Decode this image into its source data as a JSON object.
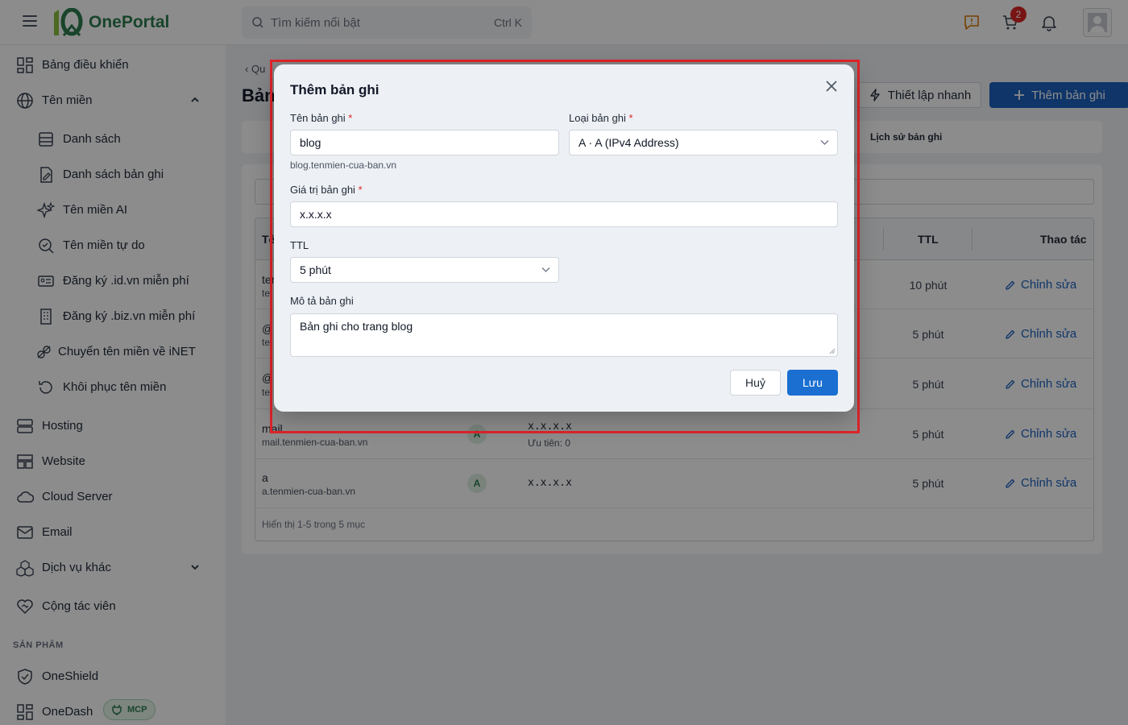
{
  "brand": {
    "name": "OnePortal",
    "accent": "#2e7d4f"
  },
  "search": {
    "placeholder": "Tìm kiếm nổi bật",
    "shortcut": "Ctrl K"
  },
  "header": {
    "cart_count": "2"
  },
  "sidebar": {
    "items": [
      {
        "label": "Bảng điều khiển",
        "icon": "dashboard-icon"
      },
      {
        "label": "Tên miền",
        "icon": "globe-icon"
      },
      {
        "label": "Danh sách",
        "icon": "list-icon"
      },
      {
        "label": "Danh sách bản ghi",
        "icon": "edit-doc-icon"
      },
      {
        "label": "Tên miền AI",
        "icon": "sparkle-icon"
      },
      {
        "label": "Tên miền tự do",
        "icon": "search-check-icon"
      },
      {
        "label": "Đăng ký .id.vn miễn phí",
        "icon": "id-card-icon"
      },
      {
        "label": "Đăng ký .biz.vn miễn phí",
        "icon": "building-icon"
      },
      {
        "label": "Chuyển tên miền về iNET",
        "icon": "transfer-icon"
      },
      {
        "label": "Khôi phục tên miền",
        "icon": "restore-icon"
      },
      {
        "label": "Hosting",
        "icon": "server-icon"
      },
      {
        "label": "Website",
        "icon": "website-icon"
      },
      {
        "label": "Cloud Server",
        "icon": "cloud-icon"
      },
      {
        "label": "Email",
        "icon": "mail-icon"
      },
      {
        "label": "Dịch vụ khác",
        "icon": "cubes-icon"
      },
      {
        "label": "Cộng tác viên",
        "icon": "handshake-icon"
      }
    ],
    "section_products": "SẢN PHẨM",
    "products": [
      {
        "label": "OneShield",
        "icon": "shield-icon"
      },
      {
        "label": "OneDash",
        "icon": "dashboard-icon",
        "badge": "MCP"
      }
    ]
  },
  "page": {
    "breadcrumb": "Qu",
    "title": "Bản",
    "btn_quick": "Thiết lập nhanh",
    "btn_add": "Thêm bản ghi",
    "tab_history": "Lịch sử bản ghi"
  },
  "table": {
    "headers": {
      "name": "Tê",
      "ttl": "TTL",
      "actions": "Thao tác"
    },
    "rows": [
      {
        "name": "ter",
        "host": "te",
        "type": "",
        "value": "",
        "priority": "",
        "ttl": "10 phút",
        "action": "Chỉnh sửa"
      },
      {
        "name": "@",
        "host": "te",
        "type": "",
        "value": "",
        "priority": "",
        "ttl": "5 phút",
        "action": "Chỉnh sửa"
      },
      {
        "name": "@",
        "host": "te",
        "type": "",
        "value": "",
        "priority": "",
        "ttl": "5 phút",
        "action": "Chỉnh sửa"
      },
      {
        "name": "mail",
        "host": "mail.tenmien-cua-ban.vn",
        "type": "A",
        "value": "x.x.x.x",
        "priority": "Ưu tiên: 0",
        "ttl": "5 phút",
        "action": "Chỉnh sửa"
      },
      {
        "name": "a",
        "host": "a.tenmien-cua-ban.vn",
        "type": "A",
        "value": "x.x.x.x",
        "priority": "",
        "ttl": "5 phút",
        "action": "Chỉnh sửa"
      }
    ],
    "footer": "Hiển thị 1-5 trong 5 mục"
  },
  "modal": {
    "title": "Thêm bản ghi",
    "name_label": "Tên bản ghi",
    "name_value": "blog",
    "name_hint": "blog.tenmien-cua-ban.vn",
    "type_label": "Loại bản ghi",
    "type_value": "A · A (IPv4 Address)",
    "value_label": "Giá trị bản ghi",
    "value_value": "x.x.x.x",
    "ttl_label": "TTL",
    "ttl_value": "5 phút",
    "desc_label": "Mô tả bản ghi",
    "desc_value": "Bản ghi cho trang blog",
    "required_mark": "*",
    "cancel": "Huỷ",
    "save": "Lưu"
  }
}
